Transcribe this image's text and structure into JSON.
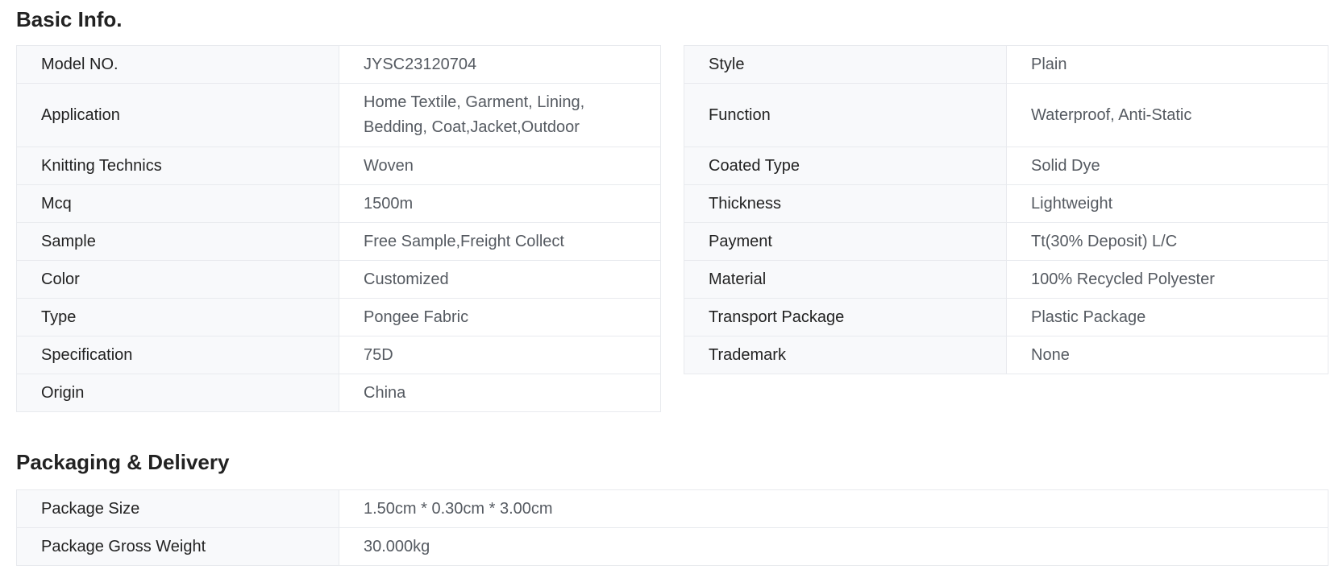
{
  "basic_info": {
    "title": "Basic Info.",
    "left": [
      {
        "label": "Model NO.",
        "value": "JYSC23120704"
      },
      {
        "label": "Application",
        "value": "Home Textile, Garment, Lining, Bedding, Coat,Jacket,Outdoor"
      },
      {
        "label": "Knitting Technics",
        "value": "Woven"
      },
      {
        "label": "Mcq",
        "value": "1500m"
      },
      {
        "label": "Sample",
        "value": "Free Sample,Freight Collect"
      },
      {
        "label": "Color",
        "value": "Customized"
      },
      {
        "label": "Type",
        "value": "Pongee Fabric"
      },
      {
        "label": "Specification",
        "value": "75D"
      },
      {
        "label": "Origin",
        "value": "China"
      }
    ],
    "right": [
      {
        "label": "Style",
        "value": "Plain"
      },
      {
        "label": "Function",
        "value": "Waterproof, Anti-Static"
      },
      {
        "label": "Coated Type",
        "value": "Solid Dye"
      },
      {
        "label": "Thickness",
        "value": "Lightweight"
      },
      {
        "label": "Payment",
        "value": "Tt(30% Deposit) L/C"
      },
      {
        "label": "Material",
        "value": "100% Recycled Polyester"
      },
      {
        "label": "Transport Package",
        "value": "Plastic Package"
      },
      {
        "label": "Trademark",
        "value": "None"
      }
    ]
  },
  "packaging": {
    "title": "Packaging & Delivery",
    "rows": [
      {
        "label": "Package Size",
        "value": "1.50cm * 0.30cm * 3.00cm"
      },
      {
        "label": "Package Gross Weight",
        "value": "30.000kg"
      }
    ]
  }
}
